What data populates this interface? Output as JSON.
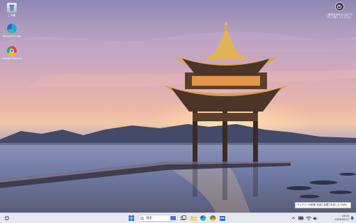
{
  "desktop": {
    "icons": [
      {
        "label": "ごみ箱",
        "icon": "recycle-bin-icon"
      },
      {
        "label": "Microsoft Edge",
        "icon": "edge-icon"
      },
      {
        "label": "Google Chrome",
        "icon": "chrome-icon"
      }
    ],
    "widget": {
      "icon": "activation-icon",
      "text": "ご使用を始めるにはアクティブ化してください"
    }
  },
  "taskbar": {
    "search_label": "検索",
    "pinned_icons": [
      "start-icon",
      "search-icon",
      "widgets-icon",
      "file-explorer-icon",
      "edge-icon",
      "chrome-icon",
      "store-icon"
    ],
    "tray_icons": [
      "chevron-up-icon",
      "battery-icon",
      "wifi-icon",
      "volume-icon"
    ],
    "clock": {
      "time": "18:04",
      "date": "2024/02/27"
    },
    "accent": "#0a64c8"
  },
  "toast": {
    "text": "バッテリーの状態: 完全に充電されました 100%"
  }
}
